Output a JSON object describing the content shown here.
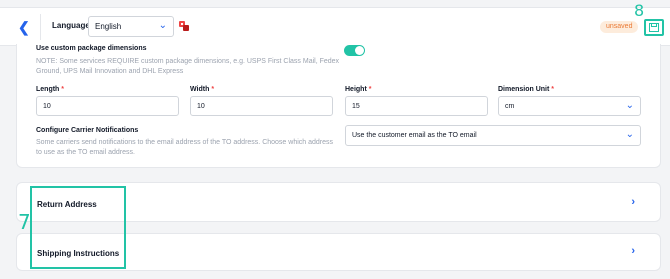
{
  "header": {
    "language_label": "Language",
    "language_value": "English",
    "unsaved_label": "unsaved"
  },
  "annotations": {
    "label8": "8",
    "label7": "7"
  },
  "custom_package": {
    "title": "Use custom package dimensions",
    "note_line1": "NOTE: Some services REQUIRE custom package dimensions, e.g. USPS First Class Mail, Fedex",
    "note_line2": "Ground, UPS Mail Innovation and DHL Express",
    "enabled": true
  },
  "fields": {
    "length": {
      "label": "Length",
      "value": "10"
    },
    "width": {
      "label": "Width",
      "value": "10"
    },
    "height": {
      "label": "Height",
      "value": "15"
    },
    "dimension_unit": {
      "label": "Dimension Unit",
      "value": "cm"
    },
    "required_mark": "*"
  },
  "carrier": {
    "title": "Configure Carrier Notifications",
    "note_line1": "Some carriers send notifications to the email address of the TO address. Choose which address",
    "note_line2": "to use as the TO email address.",
    "value": "Use the customer email as the TO email"
  },
  "sections": {
    "return_address": "Return Address",
    "shipping_instructions": "Shipping Instructions"
  },
  "colors": {
    "accent": "#22c3a6",
    "link": "#2563eb",
    "required": "#ef4444",
    "unsaved_bg": "#fdecdc",
    "unsaved_text": "#ea7a35"
  }
}
